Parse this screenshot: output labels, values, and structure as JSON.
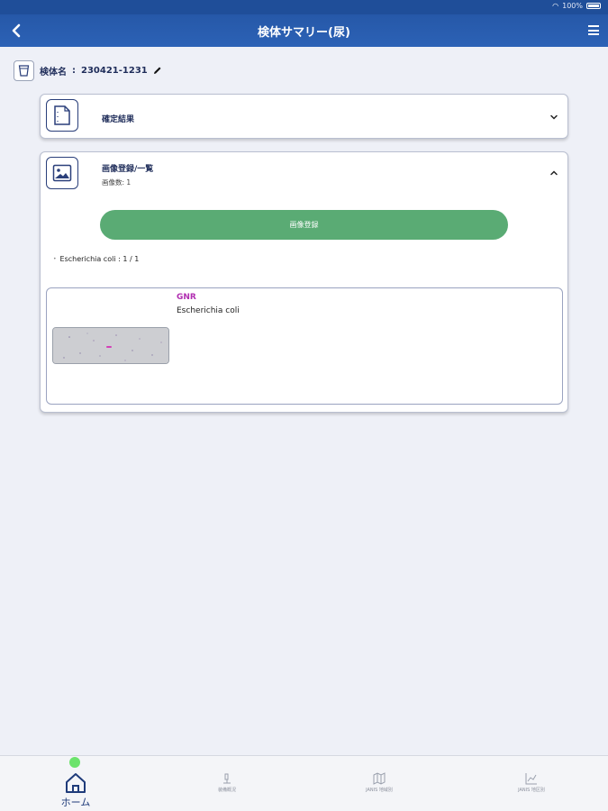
{
  "status_bar": {
    "battery": "100%"
  },
  "header": {
    "title": "検体サマリー(尿)"
  },
  "specimen": {
    "label": "検体名",
    "separator": ":",
    "value": "230421-1231"
  },
  "cards": {
    "confirmed": {
      "title": "確定結果"
    },
    "images": {
      "title": "画像登録/一覧",
      "count_text": "画像数: 1",
      "register_label": "画像登録",
      "organism_text": "Escherichia coli : 1 / 1",
      "entry": {
        "gram": "GNR",
        "species": "Escherichia coli"
      }
    }
  },
  "nav": {
    "home": "ホーム",
    "item2": "装備概況",
    "item3": "JANIS 地域別",
    "item4": "JANIS 地区別"
  },
  "colors": {
    "header": "#2c62b6",
    "button": "#5aab74",
    "gram": "#b12fb1",
    "indicator": "#6ce36c"
  }
}
